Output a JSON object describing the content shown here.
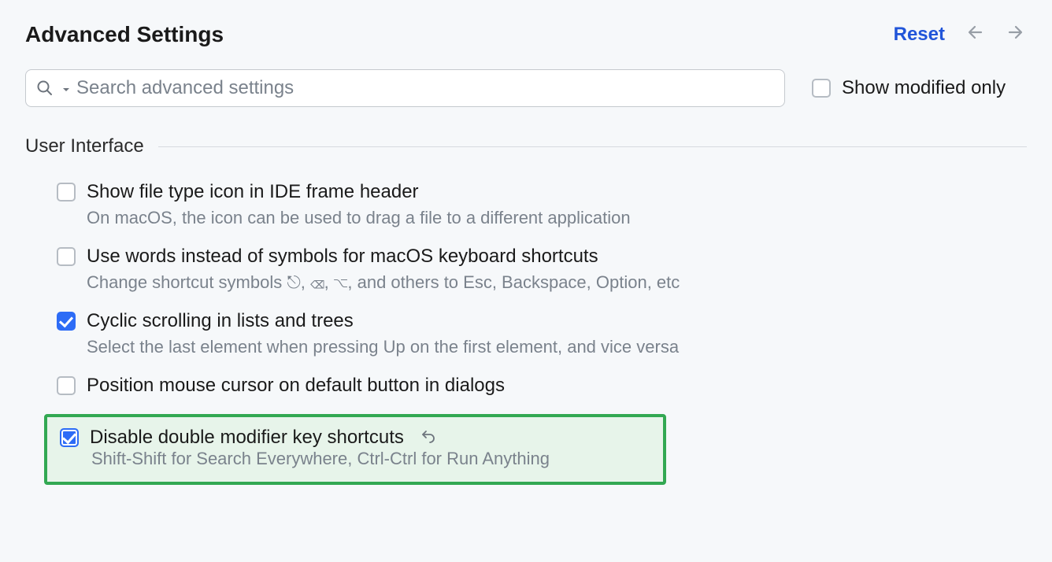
{
  "header": {
    "title": "Advanced Settings",
    "reset": "Reset"
  },
  "search": {
    "placeholder": "Search advanced settings"
  },
  "show_modified": {
    "label": "Show modified only",
    "checked": false
  },
  "section": {
    "label": "User Interface"
  },
  "settings": [
    {
      "label": "Show file type icon in IDE frame header",
      "desc": "On macOS, the icon can be used to drag a file to a different application",
      "checked": false
    },
    {
      "label": "Use words instead of symbols for macOS keyboard shortcuts",
      "desc": "Change shortcut symbols ⎋, ⌫, ⌥, and others to Esc, Backspace, Option, etc",
      "checked": false
    },
    {
      "label": "Cyclic scrolling in lists and trees",
      "desc": "Select the last element when pressing Up on the first element, and vice versa",
      "checked": true
    },
    {
      "label": "Position mouse cursor on default button in dialogs",
      "desc": "",
      "checked": false
    },
    {
      "label": "Disable double modifier key shortcuts",
      "desc": "Shift-Shift for Search Everywhere, Ctrl-Ctrl for Run Anything",
      "checked": true,
      "highlighted": true
    }
  ]
}
